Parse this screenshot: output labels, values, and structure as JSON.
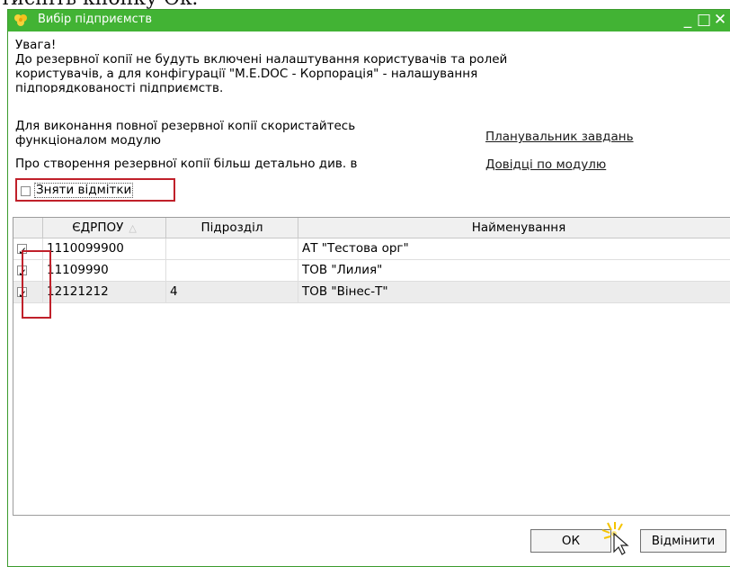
{
  "page_caption": "тисніть кнопку Ok.",
  "window": {
    "title": "Вибір підприємств",
    "minimize_label": "_",
    "maximize_label": "□",
    "close_label": "✕"
  },
  "warning": {
    "heading": "Увага!",
    "line1": "До резервної копії не будуть включені налаштування користувачів та ролей",
    "line2": "користувачів, а для конфігурації \"M.E.DOC - Корпорація\" - налашування",
    "line3": "підпорядкованості підприємств.",
    "full_backup_line1": "Для виконання повної резервної копії скористайтесь",
    "full_backup_line2": "функціоналом модулю",
    "more_info": "Про створення резервної копії більш детально див. в"
  },
  "links": {
    "scheduler": "Планувальник завдань",
    "help": "Довідці по модулю"
  },
  "uncheck_all": {
    "label": "Зняти відмітки",
    "checked": false
  },
  "table": {
    "columns": [
      "ЄДРПОУ",
      "Підрозділ",
      "Найменування"
    ],
    "rows": [
      {
        "checked": true,
        "edrpou": "1110099900",
        "subdivision": "",
        "name": "АТ \"Тестова орг\""
      },
      {
        "checked": true,
        "edrpou": "11109990",
        "subdivision": "",
        "name": "ТОВ \"Лилия\""
      },
      {
        "checked": true,
        "edrpou": "12121212",
        "subdivision": "4",
        "name": "ТОВ \"Вінес-Т\""
      }
    ]
  },
  "buttons": {
    "ok": "ОК",
    "cancel": "Відмінити"
  }
}
